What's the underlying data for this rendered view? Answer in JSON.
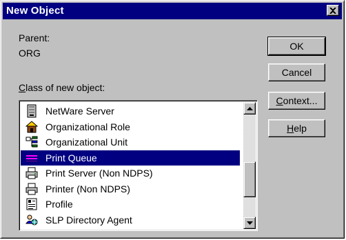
{
  "window": {
    "title": "New Object",
    "titlebar_color": "#000080",
    "face_color": "#c0c0c0"
  },
  "parent": {
    "label": "Parent:",
    "value": "ORG"
  },
  "class_list": {
    "label_mnemonic": "C",
    "label_rest": "lass of new object:",
    "items": [
      {
        "label": "NetWare Server",
        "icon": "server-icon"
      },
      {
        "label": "Organizational Role",
        "icon": "organizational-role-icon"
      },
      {
        "label": "Organizational Unit",
        "icon": "organizational-unit-icon"
      },
      {
        "label": "Print Queue",
        "icon": "print-queue-icon",
        "selected": true
      },
      {
        "label": "Print Server (Non NDPS)",
        "icon": "print-server-icon"
      },
      {
        "label": "Printer (Non NDPS)",
        "icon": "printer-icon"
      },
      {
        "label": "Profile",
        "icon": "profile-icon"
      },
      {
        "label": "SLP Directory Agent",
        "icon": "slp-directory-agent-icon"
      }
    ]
  },
  "buttons": {
    "ok": "OK",
    "cancel": "Cancel",
    "context_mnemonic": "C",
    "context_rest": "ontext...",
    "help_mnemonic": "H",
    "help_rest": "elp"
  }
}
